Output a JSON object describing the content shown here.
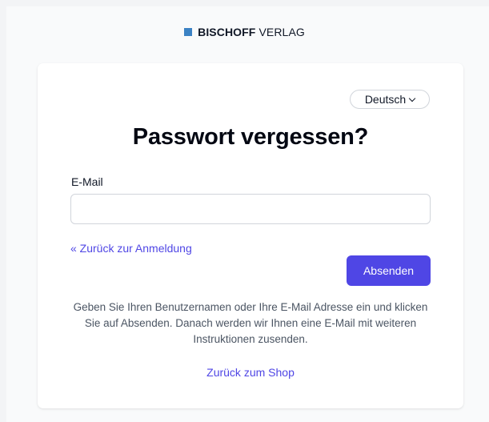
{
  "brand": {
    "name_strong": "BISCHOFF",
    "name_rest": "VERLAG",
    "accent_color": "#3b82c4"
  },
  "language": {
    "selected": "Deutsch",
    "icon": "chevron-down-icon"
  },
  "form": {
    "title": "Passwort vergessen?",
    "email_label": "E-Mail",
    "email_value": "",
    "email_placeholder": "",
    "back_to_login": "« Zurück zur Anmeldung",
    "submit_label": "Absenden",
    "help_text": "Geben Sie Ihren Benutzernamen oder Ihre E-Mail Adresse ein und klicken Sie auf Absenden. Danach werden wir Ihnen eine E-Mail mit weiteren Instruktionen zusenden.",
    "back_to_shop": "Zurück zum Shop"
  },
  "colors": {
    "primary": "#4f46e5",
    "background": "#f9fafb",
    "card": "#ffffff"
  }
}
